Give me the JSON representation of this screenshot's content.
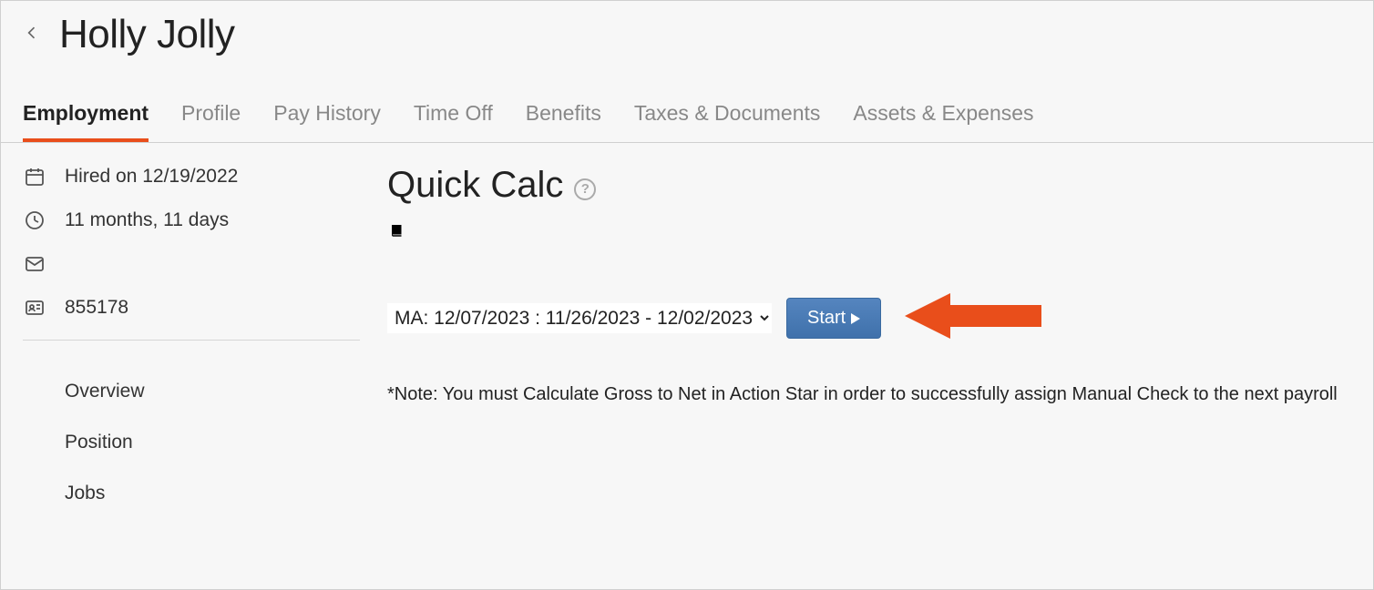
{
  "header": {
    "title": "Holly Jolly"
  },
  "tabs": [
    {
      "label": "Employment",
      "active": true
    },
    {
      "label": "Profile",
      "active": false
    },
    {
      "label": "Pay History",
      "active": false
    },
    {
      "label": "Time Off",
      "active": false
    },
    {
      "label": "Benefits",
      "active": false
    },
    {
      "label": "Taxes & Documents",
      "active": false
    },
    {
      "label": "Assets & Expenses",
      "active": false
    }
  ],
  "sidebar": {
    "hired_text": "Hired on 12/19/2022",
    "tenure_text": "11 months, 11 days",
    "employee_id": "855178",
    "nav": [
      {
        "label": "Overview"
      },
      {
        "label": "Position"
      },
      {
        "label": "Jobs"
      }
    ]
  },
  "main": {
    "title": "Quick Calc",
    "period_selected": "MA: 12/07/2023 : 11/26/2023 - 12/02/2023",
    "start_label": "Start",
    "note": "*Note: You must Calculate Gross to Net in Action Star in order to successfully assign Manual Check to the next payroll"
  },
  "annotation": {
    "arrow_color": "#e94e1b"
  }
}
